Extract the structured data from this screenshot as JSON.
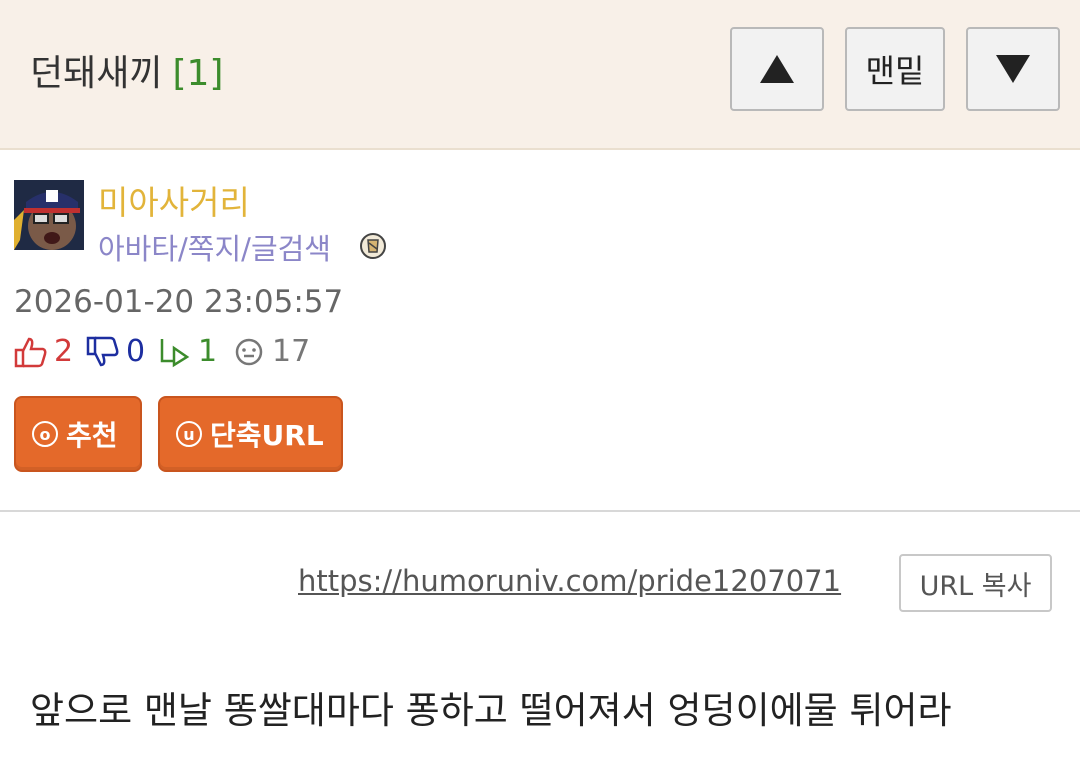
{
  "header": {
    "title": "던돼새끼",
    "comment_count": "[1]",
    "bottom_label": "맨밑"
  },
  "author": {
    "nickname": "미아사거리",
    "links": "아바타/쪽지/글검색",
    "date": "2026-01-20 23:05:57"
  },
  "stats": {
    "likes": "2",
    "dislikes": "0",
    "shares": "1",
    "views": "17"
  },
  "actions": {
    "recommend_icon": "o",
    "recommend_label": "추천",
    "short_url_icon": "u",
    "short_url_label": "단축URL"
  },
  "link": {
    "url": "https://humoruniv.com/pride1207071",
    "copy_label": "URL 복사"
  },
  "body": {
    "text": "앞으로 맨날 똥쌀대마다 퐁하고 떨어져서 엉덩이에물 튀어라"
  },
  "colors": {
    "accent_orange": "#e4692a",
    "nickname": "#e2b43a",
    "links": "#8b86c8",
    "header_bg": "#f8f0e8"
  }
}
